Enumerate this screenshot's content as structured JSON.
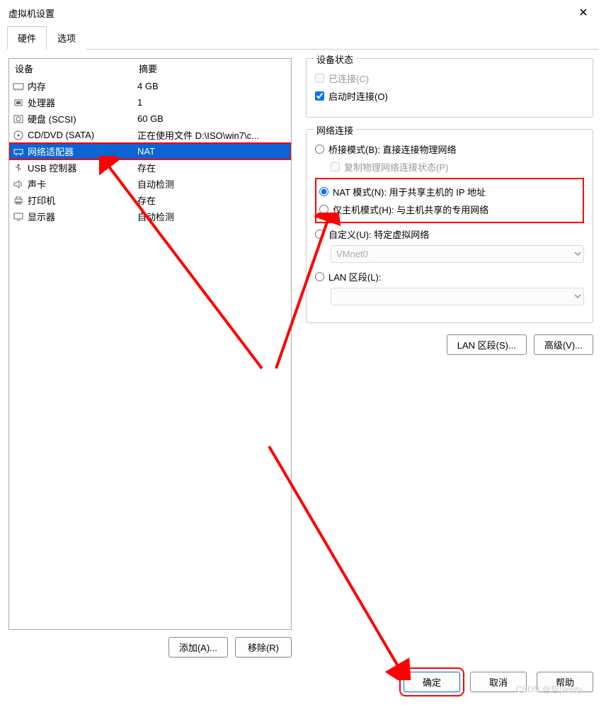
{
  "window": {
    "title": "虚拟机设置",
    "close": "✕"
  },
  "tabs": {
    "hardware": "硬件",
    "options": "选项"
  },
  "deviceList": {
    "headers": {
      "device": "设备",
      "summary": "摘要"
    },
    "items": [
      {
        "icon": "memory-icon",
        "name": "内存",
        "summary": "4 GB"
      },
      {
        "icon": "cpu-icon",
        "name": "处理器",
        "summary": "1"
      },
      {
        "icon": "disk-icon",
        "name": "硬盘 (SCSI)",
        "summary": "60 GB"
      },
      {
        "icon": "cd-icon",
        "name": "CD/DVD (SATA)",
        "summary": "正在使用文件 D:\\ISO\\win7\\c..."
      },
      {
        "icon": "network-icon",
        "name": "网络适配器",
        "summary": "NAT",
        "selected": true
      },
      {
        "icon": "usb-icon",
        "name": "USB 控制器",
        "summary": "存在"
      },
      {
        "icon": "sound-icon",
        "name": "声卡",
        "summary": "自动检测"
      },
      {
        "icon": "printer-icon",
        "name": "打印机",
        "summary": "存在"
      },
      {
        "icon": "display-icon",
        "name": "显示器",
        "summary": "自动检测"
      }
    ],
    "addBtn": "添加(A)...",
    "removeBtn": "移除(R)"
  },
  "deviceStatus": {
    "title": "设备状态",
    "connected": {
      "label": "已连接(C)",
      "checked": false
    },
    "connectAtPowerOn": {
      "label": "启动时连接(O)",
      "checked": true
    }
  },
  "network": {
    "title": "网络连接",
    "bridged": "桥接模式(B): 直接连接物理网络",
    "replicate": "复制物理网络连接状态(P)",
    "nat": "NAT 模式(N): 用于共享主机的 IP 地址",
    "hostOnly": "仅主机模式(H): 与主机共享的专用网络",
    "custom": "自定义(U): 特定虚拟网络",
    "vmnet": "VMnet0",
    "lanSegment": "LAN 区段(L):",
    "lanSegmentBtn": "LAN 区段(S)...",
    "advancedBtn": "高级(V)..."
  },
  "footer": {
    "ok": "确定",
    "cancel": "取消",
    "help": "帮助"
  },
  "watermark": "CSDN @智plenty-"
}
